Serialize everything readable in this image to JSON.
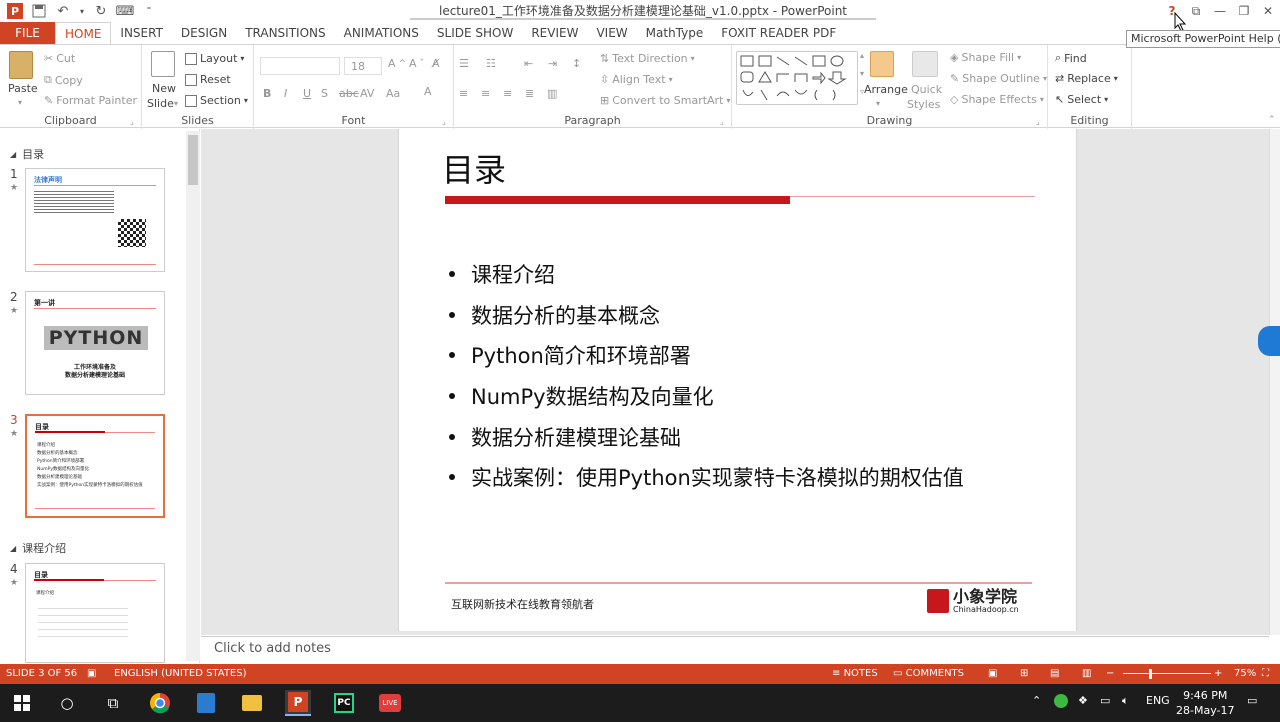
{
  "window": {
    "title": "lecture01_工作环境准备及数据分析建模理论基础_v1.0.pptx - PowerPoint",
    "tooltip": "Microsoft PowerPoint Help (F1"
  },
  "tabs": [
    {
      "label": "FILE"
    },
    {
      "label": "HOME"
    },
    {
      "label": "INSERT"
    },
    {
      "label": "DESIGN"
    },
    {
      "label": "TRANSITIONS"
    },
    {
      "label": "ANIMATIONS"
    },
    {
      "label": "SLIDE SHOW"
    },
    {
      "label": "REVIEW"
    },
    {
      "label": "VIEW"
    },
    {
      "label": "MathType"
    },
    {
      "label": "FOXIT READER PDF"
    }
  ],
  "ribbon": {
    "clipboard": {
      "paste": "Paste",
      "cut": "Cut",
      "copy": "Copy",
      "format_painter": "Format Painter",
      "label": "Clipboard"
    },
    "slides": {
      "new_slide_1": "New",
      "new_slide_2": "Slide",
      "layout": "Layout",
      "reset": "Reset",
      "section": "Section",
      "label": "Slides"
    },
    "font": {
      "size": "18",
      "label": "Font"
    },
    "paragraph": {
      "text_direction": "Text Direction",
      "align_text": "Align Text",
      "convert": "Convert to SmartArt",
      "label": "Paragraph"
    },
    "drawing": {
      "arrange": "Arrange",
      "quick_1": "Quick",
      "quick_2": "Styles",
      "shape_fill": "Shape Fill",
      "shape_outline": "Shape Outline",
      "shape_effects": "Shape Effects",
      "label": "Drawing"
    },
    "editing": {
      "find": "Find",
      "replace": "Replace",
      "select": "Select",
      "label": "Editing"
    }
  },
  "left_pane": {
    "sections": [
      {
        "label": "目录"
      },
      {
        "label": "课程介绍"
      }
    ],
    "slides": [
      {
        "num": "1",
        "title": "法律声明"
      },
      {
        "num": "2",
        "title": "第一讲",
        "big": "PYTHON",
        "sub1": "工作环境准备及",
        "sub2": "数据分析建模理论基础"
      },
      {
        "num": "3",
        "title": "目录",
        "lines": [
          "课程介绍",
          "数据分析的基本概念",
          "Python简介和环境部署",
          "NumPy数据结构及向量化",
          "数据分析建模理论基础",
          "实战案例：使用Python实现蒙特卡洛模拟的期权估值"
        ]
      },
      {
        "num": "4",
        "title": "目录",
        "lines": [
          "课程介绍"
        ]
      }
    ]
  },
  "slide": {
    "title": "目录",
    "bullets": [
      "课程介绍",
      "数据分析的基本概念",
      "Python简介和环境部署",
      "NumPy数据结构及向量化",
      "数据分析建模理论基础",
      "实战案例：使用Python实现蒙特卡洛模拟的期权估值"
    ],
    "footer": "互联网新技术在线教育领航者",
    "logo_main": "小象学院",
    "logo_sub": "ChinaHadoop.cn",
    "accent": "#c8161d"
  },
  "notes_placeholder": "Click to add notes",
  "status": {
    "slide": "SLIDE 3 OF 56",
    "language": "ENGLISH (UNITED STATES)",
    "notes": "NOTES",
    "comments": "COMMENTS",
    "zoom": "75%"
  },
  "taskbar": {
    "lang": "ENG",
    "time": "9:46 PM",
    "date": "28-May-17"
  },
  "colors": {
    "brand": "#d04423"
  }
}
